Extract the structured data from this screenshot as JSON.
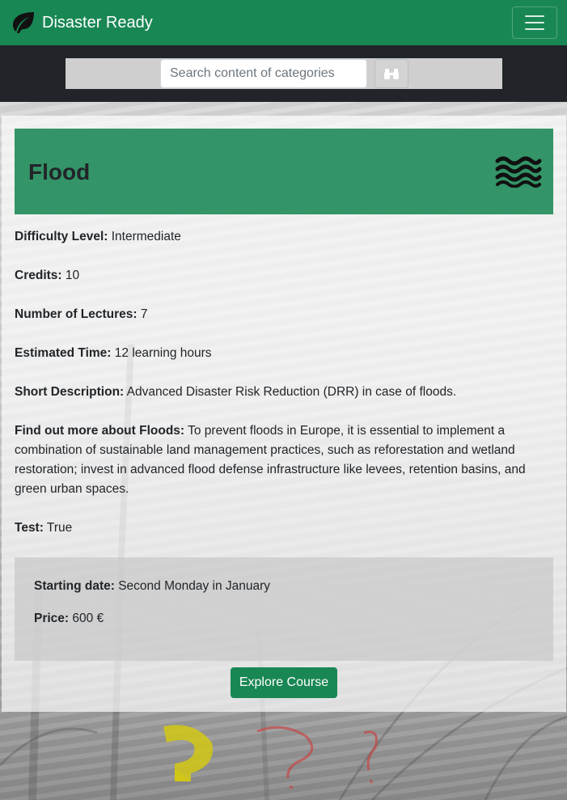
{
  "navbar": {
    "brand": "Disaster Ready",
    "brand_icon": "leaf-icon",
    "menu_icon": "hamburger-menu-icon",
    "color": "#198754"
  },
  "search": {
    "placeholder": "Search content of categories",
    "button_icon": "binoculars-icon"
  },
  "course": {
    "title": "Flood",
    "header_icon": "water-waves-icon",
    "fields": {
      "difficulty_label": "Difficulty Level:",
      "difficulty_value": "Intermediate",
      "credits_label": "Credits:",
      "credits_value": "10",
      "lectures_label": "Number of Lectures:",
      "lectures_value": "7",
      "time_label": "Estimated Time:",
      "time_value": "12 learning hours",
      "short_desc_label": "Short Description:",
      "short_desc_value": "Advanced Disaster Risk Reduction (DRR) in case of floods.",
      "more_label": "Find out more about Floods:",
      "more_value": "To prevent floods in Europe, it is essential to implement a combination of sustainable land management practices, such as reforestation and wetland restoration; invest in advanced flood defense infrastructure like levees, retention basins, and green urban spaces.",
      "test_label": "Test:",
      "test_value": "True"
    },
    "info": {
      "start_label": "Starting date:",
      "start_value": "Second Monday in January",
      "price_label": "Price:",
      "price_value": "600  €"
    },
    "explore_label": "Explore Course"
  },
  "colors": {
    "accent": "#198754",
    "dark": "#212529"
  }
}
